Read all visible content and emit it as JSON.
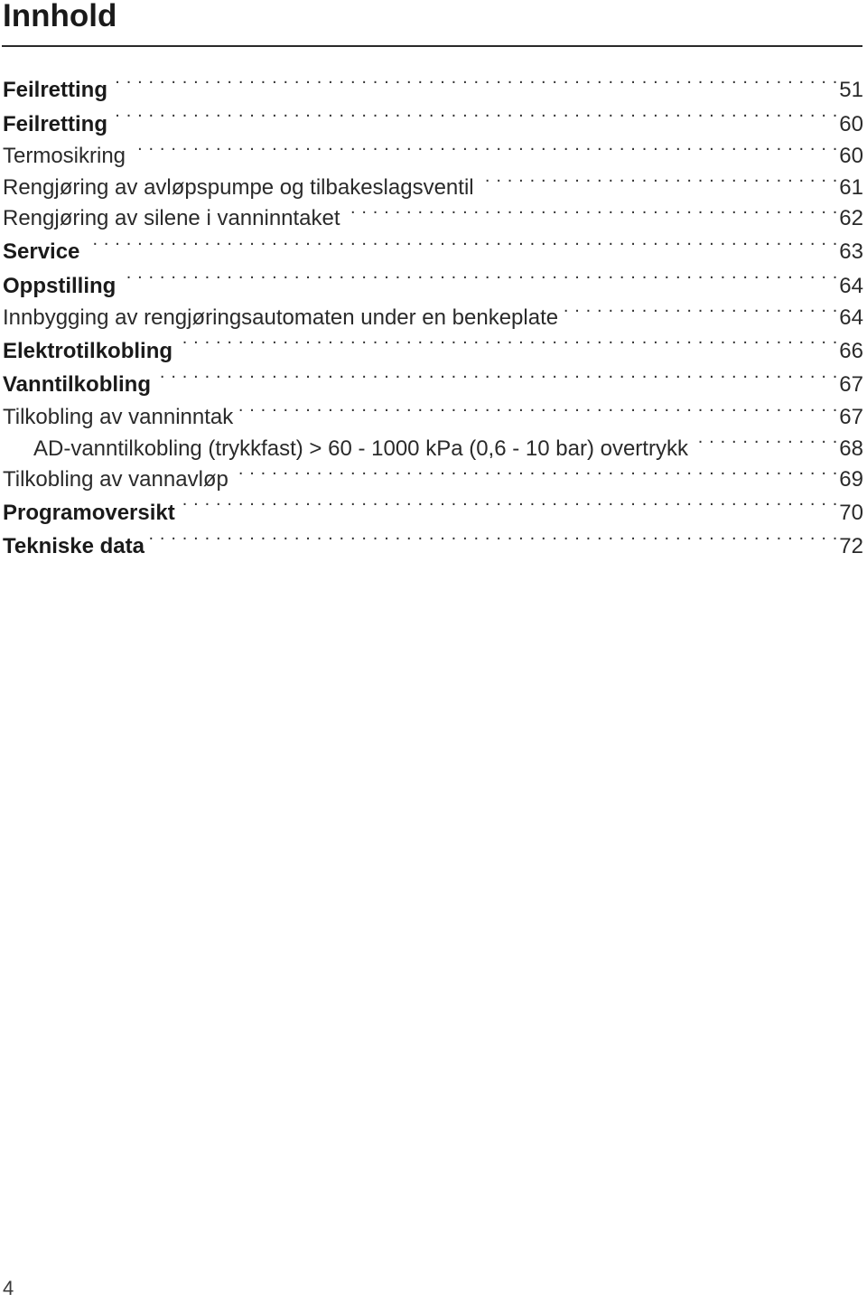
{
  "page": {
    "title": "Innhold",
    "page_number": "4"
  },
  "toc": {
    "entries": [
      {
        "label": "Feilretting",
        "page": "51",
        "level": 1
      },
      {
        "label": "Feilretting",
        "page": "60",
        "level": 1
      },
      {
        "label": "Termosikring",
        "page": "60",
        "level": 2
      },
      {
        "label": "Rengjøring av avløpspumpe og tilbakeslagsventil",
        "page": "61",
        "level": 2
      },
      {
        "label": "Rengjøring av silene i vanninntaket",
        "page": "62",
        "level": 2
      },
      {
        "label": "Service",
        "page": "63",
        "level": 1
      },
      {
        "label": "Oppstilling",
        "page": "64",
        "level": 1
      },
      {
        "label": "Innbygging av rengjøringsautomaten under en benkeplate",
        "page": "64",
        "level": 2
      },
      {
        "label": "Elektrotilkobling",
        "page": "66",
        "level": 1
      },
      {
        "label": "Vanntilkobling",
        "page": "67",
        "level": 1
      },
      {
        "label": "Tilkobling av vanninntak",
        "page": "67",
        "level": 2
      },
      {
        "label": "AD-vanntilkobling (trykkfast) > 60 - 1000 kPa (0,6 - 10 bar) overtrykk",
        "page": "68",
        "level": 3
      },
      {
        "label": "Tilkobling av vannavløp",
        "page": "69",
        "level": 2
      },
      {
        "label": "Programoversikt",
        "page": "70",
        "level": 1
      },
      {
        "label": "Tekniske data",
        "page": "72",
        "level": 1
      }
    ]
  }
}
